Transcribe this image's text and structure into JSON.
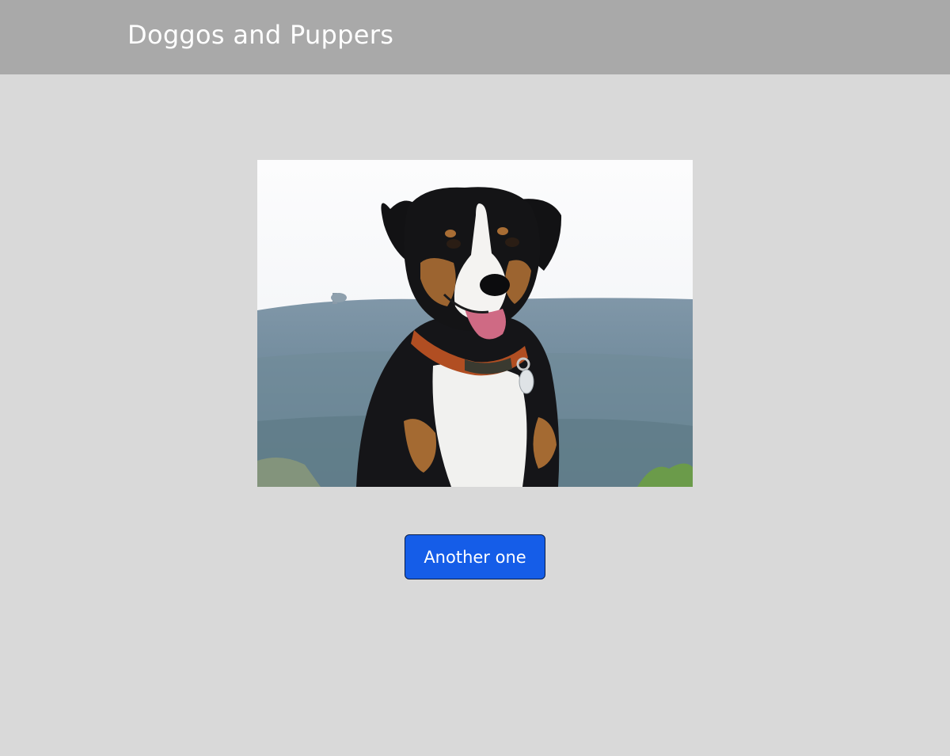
{
  "header": {
    "title": "Doggos and Puppers",
    "background_color": "#a9a9a9"
  },
  "main": {
    "photo": {
      "subject": "dog-photo",
      "alt": ""
    },
    "button": {
      "label": "Another one",
      "color": "#155de8"
    }
  },
  "page": {
    "background_color": "#d9d9d9"
  }
}
